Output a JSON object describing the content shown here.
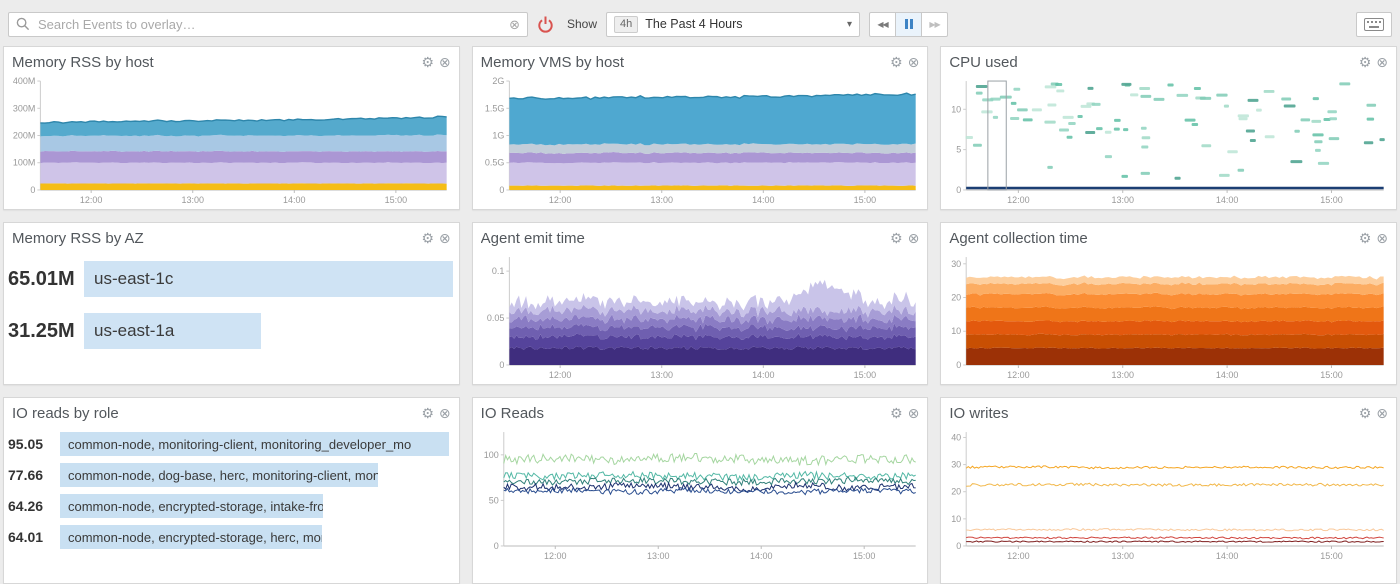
{
  "topbar": {
    "search_placeholder": "Search Events to overlay…",
    "show_label": "Show",
    "range_badge": "4h",
    "range_value": "The Past 4 Hours"
  },
  "widgets": {
    "memory_rss_by_host": {
      "title": "Memory RSS by host"
    },
    "memory_vms_by_host": {
      "title": "Memory VMS by host"
    },
    "cpu_used": {
      "title": "CPU used"
    },
    "memory_rss_by_az": {
      "title": "Memory RSS by AZ",
      "rows": [
        {
          "value": 65.01,
          "display": "65.01M",
          "label": "us-east-1c"
        },
        {
          "value": 31.25,
          "display": "31.25M",
          "label": "us-east-1a"
        }
      ]
    },
    "agent_emit_time": {
      "title": "Agent emit time"
    },
    "agent_collection_time": {
      "title": "Agent collection time"
    },
    "io_reads_by_role": {
      "title": "IO reads by role",
      "rows": [
        {
          "value": 95.05,
          "display": "95.05",
          "label": "common-node, monitoring-client, monitoring_developer_mo"
        },
        {
          "value": 77.66,
          "display": "77.66",
          "label": "common-node, dog-base, herc, monitoring-client, monitorin…"
        },
        {
          "value": 64.26,
          "display": "64.26",
          "label": "common-node, encrypted-storage, intake-frontend, monitori…"
        },
        {
          "value": 64.01,
          "display": "64.01",
          "label": "common-node, encrypted-storage, herc, monitoring-client, …"
        }
      ]
    },
    "io_reads": {
      "title": "IO Reads"
    },
    "io_writes": {
      "title": "IO writes"
    }
  },
  "chart_data": [
    {
      "el": "chart-mem-rss-host",
      "title": "Memory RSS by host",
      "type": "area",
      "stacked": true,
      "ylim": [
        0,
        400
      ],
      "samples": 90,
      "y_ticks": [
        {
          "v": 0,
          "label": "0"
        },
        {
          "v": 100,
          "label": "100M"
        },
        {
          "v": 200,
          "label": "200M"
        },
        {
          "v": 300,
          "label": "300M"
        },
        {
          "v": 400,
          "label": "400M"
        }
      ],
      "x_ticks": [
        {
          "t": 0.125,
          "label": "12:00"
        },
        {
          "t": 0.375,
          "label": "13:00"
        },
        {
          "t": 0.625,
          "label": "14:00"
        },
        {
          "t": 0.875,
          "label": "15:00"
        }
      ],
      "series": [
        {
          "color": "#f5bd16",
          "values": [
            24,
            24
          ],
          "noise": 0.5
        },
        {
          "color": "#cfc4e8",
          "values": [
            76,
            76
          ],
          "noise": 1.5
        },
        {
          "color": "#ab97d4",
          "values": [
            42,
            42
          ],
          "noise": 1.0
        },
        {
          "color": "#a8c8e4",
          "values": [
            56,
            57,
            57,
            58,
            58,
            59,
            60
          ],
          "noise": 1.5
        },
        {
          "color": "#55aacd",
          "values": [
            50,
            52,
            54,
            55,
            57,
            60,
            63,
            68
          ],
          "noise": 2.0,
          "stroke": "#2e86ab"
        }
      ]
    },
    {
      "el": "chart-mem-vms-host",
      "title": "Memory VMS by host",
      "type": "area",
      "stacked": true,
      "ylim": [
        0,
        2
      ],
      "samples": 90,
      "y_ticks": [
        {
          "v": 0,
          "label": "0"
        },
        {
          "v": 0.5,
          "label": "0.5G"
        },
        {
          "v": 1,
          "label": "1G"
        },
        {
          "v": 1.5,
          "label": "1.5G"
        },
        {
          "v": 2,
          "label": "2G"
        }
      ],
      "x_ticks": [
        {
          "t": 0.125,
          "label": "12:00"
        },
        {
          "t": 0.375,
          "label": "13:00"
        },
        {
          "t": 0.625,
          "label": "14:00"
        },
        {
          "t": 0.875,
          "label": "15:00"
        }
      ],
      "series": [
        {
          "color": "#f5bd16",
          "values": [
            0.08,
            0.08
          ],
          "noise": 0.005
        },
        {
          "color": "#cfc4e8",
          "values": [
            0.42,
            0.42
          ],
          "noise": 0.01
        },
        {
          "color": "#ab97d4",
          "values": [
            0.18,
            0.18
          ],
          "noise": 0.008
        },
        {
          "color": "#c3cdd9",
          "values": [
            0.16,
            0.16
          ],
          "noise": 0.008
        },
        {
          "color": "#4fa8d0",
          "values": [
            0.84,
            0.85,
            0.86,
            0.87,
            0.88,
            0.9,
            0.92
          ],
          "noise": 0.015,
          "stroke": "#2e86ab"
        }
      ]
    },
    {
      "el": "chart-cpu-used",
      "title": "CPU used",
      "type": "heatmap",
      "ylim": [
        0,
        13.5
      ],
      "cols": 46,
      "y_ticks": [
        {
          "v": 0,
          "label": "0"
        },
        {
          "v": 5,
          "label": "5"
        },
        {
          "v": 10,
          "label": "10"
        }
      ],
      "x_ticks": [
        {
          "t": 0.125,
          "label": "12:00"
        },
        {
          "t": 0.375,
          "label": "13:00"
        },
        {
          "t": 0.625,
          "label": "14:00"
        },
        {
          "t": 0.875,
          "label": "15:00"
        }
      ],
      "bands": [
        {
          "y0": 8.5,
          "y1": 13.2,
          "d0": 0.95,
          "d1": 0.35
        },
        {
          "y0": 5.0,
          "y1": 8.5,
          "d0": 0.2,
          "d1": 0.45
        },
        {
          "y0": 1.2,
          "y1": 5.0,
          "d0": 0.05,
          "d1": 0.35
        }
      ],
      "palette": [
        "#9fd9c6",
        "#7fcbb5",
        "#bce5d6",
        "#5fbfa5",
        "#8fd4c0",
        "#47a08c"
      ],
      "baseline": {
        "v": 0.25,
        "color": "#1b3e73",
        "width": 2.5
      },
      "marker_box": {
        "x0": 0.052,
        "x1": 0.096
      }
    },
    {
      "el": "chart-agent-emit",
      "title": "Agent emit time",
      "type": "area",
      "stacked": true,
      "ylim": [
        0,
        0.115
      ],
      "samples": 170,
      "y_ticks": [
        {
          "v": 0,
          "label": "0"
        },
        {
          "v": 0.05,
          "label": "0.05"
        },
        {
          "v": 0.1,
          "label": "0.1"
        }
      ],
      "x_ticks": [
        {
          "t": 0.125,
          "label": "12:00"
        },
        {
          "t": 0.375,
          "label": "13:00"
        },
        {
          "t": 0.625,
          "label": "14:00"
        },
        {
          "t": 0.875,
          "label": "15:00"
        }
      ],
      "series": [
        {
          "color": "#3f2d7e",
          "values": [
            0.018,
            0.018
          ],
          "noise": 0.002
        },
        {
          "color": "#55439b",
          "values": [
            0.012,
            0.012
          ],
          "noise": 0.002
        },
        {
          "color": "#6f5fb0",
          "values": [
            0.01,
            0.01
          ],
          "noise": 0.002
        },
        {
          "color": "#8a7cc4",
          "values": [
            0.009,
            0.009
          ],
          "noise": 0.003
        },
        {
          "color": "#a79dd6",
          "values": [
            0.009,
            0.009
          ],
          "noise": 0.003
        },
        {
          "color": "#c9c4e9",
          "values": [
            0.009,
            0.009,
            0.011,
            0.009,
            0.009,
            0.01,
            0.009,
            0.03,
            0.009,
            0.013
          ],
          "noise": 0.004
        }
      ]
    },
    {
      "el": "chart-agent-collection",
      "title": "Agent collection time",
      "type": "area",
      "stacked": true,
      "ylim": [
        0,
        32
      ],
      "samples": 120,
      "y_ticks": [
        {
          "v": 0,
          "label": "0"
        },
        {
          "v": 10,
          "label": "10"
        },
        {
          "v": 20,
          "label": "20"
        },
        {
          "v": 30,
          "label": "30"
        }
      ],
      "x_ticks": [
        {
          "t": 0.125,
          "label": "12:00"
        },
        {
          "t": 0.375,
          "label": "13:00"
        },
        {
          "t": 0.625,
          "label": "14:00"
        },
        {
          "t": 0.875,
          "label": "15:00"
        }
      ],
      "series": [
        {
          "color": "#9c3106",
          "values": [
            5,
            5
          ],
          "noise": 0.15
        },
        {
          "color": "#c84f03",
          "values": [
            4,
            4
          ],
          "noise": 0.15
        },
        {
          "color": "#e3590e",
          "values": [
            4,
            4
          ],
          "noise": 0.15
        },
        {
          "color": "#ef7518",
          "values": [
            4,
            4
          ],
          "noise": 0.2
        },
        {
          "color": "#fb8d34",
          "values": [
            4,
            4
          ],
          "noise": 0.2
        },
        {
          "color": "#fcad63",
          "values": [
            3,
            3
          ],
          "noise": 0.2
        },
        {
          "color": "#fdcf9e",
          "values": [
            2,
            2
          ],
          "noise": 0.2
        }
      ]
    },
    {
      "el": "chart-io-reads",
      "title": "IO Reads",
      "type": "line",
      "samples": 220,
      "ylim": [
        0,
        125
      ],
      "y_ticks": [
        {
          "v": 0,
          "label": "0"
        },
        {
          "v": 50,
          "label": "50"
        },
        {
          "v": 100,
          "label": "100"
        }
      ],
      "x_ticks": [
        {
          "t": 0.125,
          "label": "12:00"
        },
        {
          "t": 0.375,
          "label": "13:00"
        },
        {
          "t": 0.625,
          "label": "14:00"
        },
        {
          "t": 0.875,
          "label": "15:00"
        }
      ],
      "series": [
        {
          "color": "#a5d6a0",
          "values": [
            95,
            96,
            94,
            97,
            95,
            93,
            96,
            95
          ],
          "noise": 5
        },
        {
          "color": "#53b8a5",
          "values": [
            77,
            76,
            78,
            77,
            75,
            78,
            76,
            77
          ],
          "noise": 4
        },
        {
          "color": "#2f7f78",
          "values": [
            71,
            70,
            72,
            71,
            70,
            71,
            72,
            70
          ],
          "noise": 3.5
        },
        {
          "color": "#1b2f6e",
          "values": [
            65,
            64,
            66,
            65,
            63,
            66,
            64,
            65
          ],
          "noise": 4
        },
        {
          "color": "#2a4d8f",
          "values": [
            60,
            61,
            59,
            61,
            60,
            59,
            61,
            60
          ],
          "noise": 3
        }
      ]
    },
    {
      "el": "chart-io-writes",
      "title": "IO writes",
      "type": "line",
      "samples": 200,
      "ylim": [
        0,
        42
      ],
      "y_ticks": [
        {
          "v": 0,
          "label": "0"
        },
        {
          "v": 10,
          "label": "10"
        },
        {
          "v": 20,
          "label": "20"
        },
        {
          "v": 30,
          "label": "30"
        },
        {
          "v": 40,
          "label": "40"
        }
      ],
      "x_ticks": [
        {
          "t": 0.125,
          "label": "12:00"
        },
        {
          "t": 0.375,
          "label": "13:00"
        },
        {
          "t": 0.625,
          "label": "14:00"
        },
        {
          "t": 0.875,
          "label": "15:00"
        }
      ],
      "series": [
        {
          "color": "#f5a623",
          "values": [
            29,
            29.2,
            28.8,
            29,
            29.1,
            28.9,
            29
          ],
          "noise": 0.4
        },
        {
          "color": "#f2b84b",
          "values": [
            22.5,
            22.7,
            22.4,
            22.6,
            22.5
          ],
          "noise": 0.5
        },
        {
          "color": "#f9c89a",
          "values": [
            6,
            6.1,
            5.9,
            6
          ],
          "noise": 0.35
        },
        {
          "color": "#d0453e",
          "values": [
            3,
            3,
            3.1,
            2.9,
            3
          ],
          "noise": 0.3
        },
        {
          "color": "#7e1c1c",
          "values": [
            1.6,
            1.6
          ],
          "noise": 0.25
        }
      ]
    }
  ]
}
